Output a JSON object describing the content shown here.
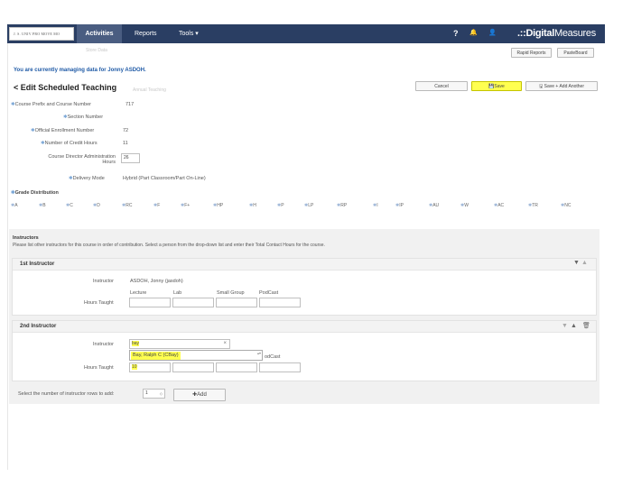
{
  "nav": {
    "logo_text": "J. S. UNIV PRO MOVE MO",
    "tabs": [
      {
        "label": "Activities"
      },
      {
        "label": "Reports"
      },
      {
        "label": "Tools ▾"
      }
    ],
    "icons": [
      "help-icon",
      "notifications-icon",
      "user-icon"
    ],
    "help_glyph": "?",
    "bell_glyph": "🔔",
    "user_glyph": "👤",
    "brand_bold": ".::Digital",
    "brand_rest": "Measures"
  },
  "faint": {
    "store_data": "Store Data",
    "annual_teaching": "Annual Teaching"
  },
  "header_buttons": {
    "rapid_reports": "Rapid Reports",
    "pasteboard": "PasteBoard"
  },
  "managing_text": "You are currently managing data for Jonny ASDOH.",
  "page_title": "< Edit Scheduled Teaching",
  "actions": {
    "cancel": "Cancel",
    "save": "💾Save",
    "save_add": "🖫 Save + Add Another"
  },
  "fields": {
    "course_prefix_label": "Course Prefix and Course Number",
    "course_prefix_value": "717",
    "section_label": "Section Number",
    "enrollment_label": "Official Enrollment Number",
    "enrollment_value": "72",
    "credit_label": "Number of Credit Hours",
    "credit_value": "11",
    "director_label_1": "Course Director Administration",
    "director_label_2": "Hours",
    "director_value": "26",
    "delivery_label": "Delivery Mode",
    "delivery_value": "Hybrid (Part Classroom/Part On-Line)"
  },
  "grade_distribution": {
    "label": "Grade Distribution",
    "grades": [
      "A",
      "B",
      "C",
      "D",
      "RC",
      "F",
      "F+",
      "HP",
      "H",
      "P",
      "LP",
      "RP",
      "I",
      "IP",
      "AU",
      "W",
      "AC",
      "TR",
      "NC"
    ]
  },
  "instructors": {
    "title": "Instructors",
    "description": "Please list other instructors for this course in order of contribution. Select a person from the drop-down list and enter their Total Contact Hours for the course.",
    "first": {
      "heading": "1st Instructor",
      "instructor_label": "Instructor",
      "instructor_value": "ASDOH, Jonny (jasdoh)",
      "columns": [
        "Lecture",
        "Lab",
        "Small Group",
        "PodCast"
      ],
      "hours_label": "Hours Taught"
    },
    "second": {
      "heading": "2nd Instructor",
      "instructor_label": "Instructor",
      "instructor_input": "bay",
      "dropdown_option": "Bay, Ralph C (CBay)",
      "partial_column": "odCast",
      "hours_label": "Hours Taught",
      "hours_value": "10"
    },
    "rows_label": "Select the number of instructor rows to add:",
    "rows_value": "1",
    "add_button": "✚Add"
  },
  "colors": {
    "nav_bg": "#2a3e63",
    "highlight": "#ffff50",
    "link_blue": "#1f5aa6"
  }
}
